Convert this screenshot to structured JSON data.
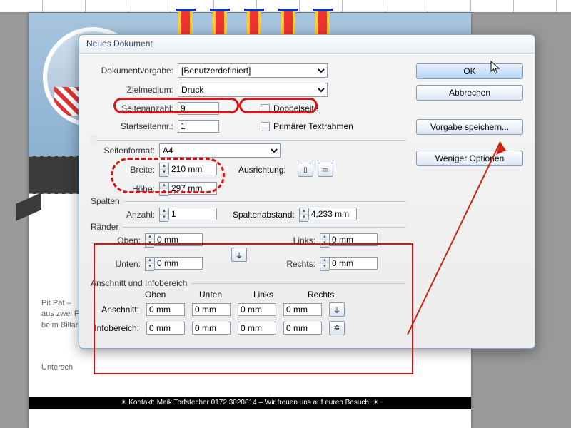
{
  "background": {
    "side_text": "Pit Pat –\naus zwei F\nbeim Billar",
    "underscore": "Untersch",
    "footer": "✴ Kontakt: Maik Torfstecher 0172 3020814 – Wir freuen uns auf euren Besuch! ✴"
  },
  "dialog": {
    "title": "Neues Dokument",
    "labels": {
      "preset": "Dokumentvorgabe:",
      "intent": "Zielmedium:",
      "pages": "Seitenanzahl:",
      "start": "Startseitennr.:",
      "facing": "Doppelseite",
      "primary": "Primärer Textrahmen",
      "pagesize": "Seitenformat:",
      "width": "Breite:",
      "height": "Höhe:",
      "orientation": "Ausrichtung:",
      "columns": "Spalten",
      "col_count": "Anzahl:",
      "gutter": "Spaltenabstand:",
      "margins": "Ränder",
      "top": "Oben:",
      "bottom": "Unten:",
      "left": "Links:",
      "right": "Rechts:",
      "bleed": "Anschnitt und Infobereich",
      "bleed_h": {
        "top": "Oben",
        "bottom": "Unten",
        "left": "Links",
        "right": "Rechts"
      },
      "bleed_row": "Anschnitt:",
      "slug_row": "Infobereich:"
    },
    "values": {
      "preset": "[Benutzerdefiniert]",
      "intent": "Druck",
      "pages": "9",
      "start": "1",
      "facing": false,
      "primary": false,
      "pagesize": "A4",
      "width": "210 mm",
      "height": "297 mm",
      "col_count": "1",
      "gutter": "4,233 mm",
      "margin": {
        "top": "0 mm",
        "bottom": "0 mm",
        "left": "0 mm",
        "right": "0 mm"
      },
      "bleed": {
        "top": "0 mm",
        "bottom": "0 mm",
        "left": "0 mm",
        "right": "0 mm"
      },
      "slug": {
        "top": "0 mm",
        "bottom": "0 mm",
        "left": "0 mm",
        "right": "0 mm"
      }
    },
    "buttons": {
      "ok": "OK",
      "cancel": "Abbrechen",
      "save": "Vorgabe speichern...",
      "less": "Weniger Optionen"
    }
  }
}
